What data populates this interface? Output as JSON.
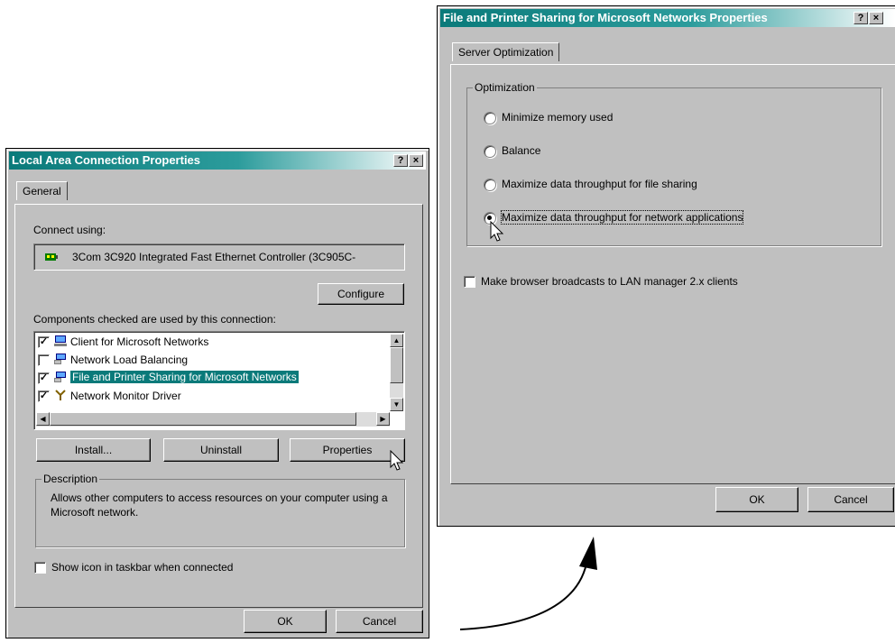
{
  "left_window": {
    "title": "Local Area Connection Properties",
    "help_btn": "?",
    "close_btn": "×",
    "tab_general": "General",
    "connect_using_label": "Connect using:",
    "adapter_name": "3Com 3C920 Integrated Fast Ethernet Controller (3C905C-",
    "configure_label": "Configure",
    "components_label": "Components checked are used by this connection:",
    "components": [
      {
        "label": "Client for Microsoft Networks",
        "checked": true,
        "icon": "network-client-icon"
      },
      {
        "label": "Network Load Balancing",
        "checked": false,
        "icon": "network-service-icon"
      },
      {
        "label": "File and Printer Sharing for Microsoft Networks",
        "checked": true,
        "icon": "network-service-icon",
        "selected": true
      },
      {
        "label": "Network Monitor Driver",
        "checked": true,
        "icon": "protocol-icon"
      }
    ],
    "install_label": "Install...",
    "uninstall_label": "Uninstall",
    "properties_label": "Properties",
    "description_title": "Description",
    "description_text": "Allows other computers to access resources on your computer using a Microsoft network.",
    "show_icon_label": "Show icon in taskbar when connected",
    "show_icon_checked": false,
    "ok_label": "OK",
    "cancel_label": "Cancel"
  },
  "right_window": {
    "title": "File and Printer Sharing for Microsoft Networks Properties",
    "help_btn": "?",
    "close_btn": "×",
    "tab_server": "Server Optimization",
    "optimization_title": "Optimization",
    "options": [
      {
        "label": "Minimize memory used",
        "selected": false
      },
      {
        "label": "Balance",
        "selected": false
      },
      {
        "label": "Maximize data throughput for file sharing",
        "selected": false
      },
      {
        "label": "Maximize data throughput for network applications",
        "selected": true
      }
    ],
    "browser_broadcasts_label": "Make browser broadcasts to LAN manager 2.x clients",
    "browser_broadcasts_checked": false,
    "ok_label": "OK",
    "cancel_label": "Cancel"
  },
  "colors": {
    "titlebar": "#0a7a7a",
    "face": "#c0c0c0",
    "selection": "#0a7a7a"
  }
}
